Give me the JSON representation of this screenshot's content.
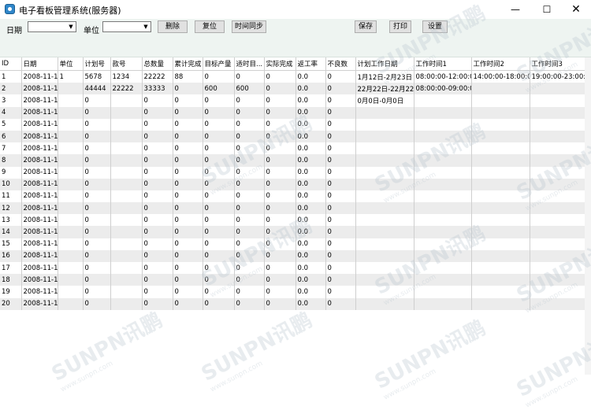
{
  "window": {
    "title": "电子看板管理系统(服务器)",
    "min": "—",
    "max": "☐",
    "close": "✕"
  },
  "toolbar": {
    "date_label": "日期",
    "unit_label": "单位",
    "date_value": "",
    "unit_value": "",
    "delete_label": "删除",
    "reset_label": "复位",
    "sync_label": "时间同步",
    "save_label": "保存",
    "print_label": "打印",
    "settings_label": "设置"
  },
  "grid": {
    "columns": [
      "ID",
      "日期",
      "单位",
      "计划号",
      "款号",
      "总数量",
      "累计完成",
      "目标产量",
      "适时目...",
      "实际完成",
      "返工率",
      "不良数",
      "计划工作日期",
      "工作时间1",
      "工作时间2",
      "工作时间3"
    ],
    "rows": [
      [
        "1",
        "2008-11-19",
        "1",
        "5678",
        "1234",
        "22222",
        "88",
        "0",
        "0",
        "0",
        "0.0",
        "0",
        "1月12日-2月23日",
        "08:00:00-12:00:00",
        "14:00:00-18:00:00",
        "19:00:00-23:00:00"
      ],
      [
        "2",
        "2008-11-18",
        "",
        "44444",
        "22222",
        "33333",
        "0",
        "600",
        "600",
        "0",
        "0.0",
        "0",
        "22月22日-22月22日",
        "08:00:00-09:00:00",
        "",
        ""
      ],
      [
        "3",
        "2008-11-15",
        "",
        "0",
        "",
        "0",
        "0",
        "0",
        "0",
        "0",
        "0.0",
        "0",
        "0月0日-0月0日",
        "",
        "",
        ""
      ],
      [
        "4",
        "2008-11-15",
        "",
        "0",
        "",
        "0",
        "0",
        "0",
        "0",
        "0",
        "0.0",
        "0",
        "",
        "",
        "",
        ""
      ],
      [
        "5",
        "2008-11-15",
        "",
        "0",
        "",
        "0",
        "0",
        "0",
        "0",
        "0",
        "0.0",
        "0",
        "",
        "",
        "",
        ""
      ],
      [
        "6",
        "2008-11-15",
        "",
        "0",
        "",
        "0",
        "0",
        "0",
        "0",
        "0",
        "0.0",
        "0",
        "",
        "",
        "",
        ""
      ],
      [
        "7",
        "2008-11-15",
        "",
        "0",
        "",
        "0",
        "0",
        "0",
        "0",
        "0",
        "0.0",
        "0",
        "",
        "",
        "",
        ""
      ],
      [
        "8",
        "2008-11-15",
        "",
        "0",
        "",
        "0",
        "0",
        "0",
        "0",
        "0",
        "0.0",
        "0",
        "",
        "",
        "",
        ""
      ],
      [
        "9",
        "2008-11-15",
        "",
        "0",
        "",
        "0",
        "0",
        "0",
        "0",
        "0",
        "0.0",
        "0",
        "",
        "",
        "",
        ""
      ],
      [
        "10",
        "2008-11-15",
        "",
        "0",
        "",
        "0",
        "0",
        "0",
        "0",
        "0",
        "0.0",
        "0",
        "",
        "",
        "",
        ""
      ],
      [
        "11",
        "2008-11-15",
        "",
        "0",
        "",
        "0",
        "0",
        "0",
        "0",
        "0",
        "0.0",
        "0",
        "",
        "",
        "",
        ""
      ],
      [
        "12",
        "2008-11-15",
        "",
        "0",
        "",
        "0",
        "0",
        "0",
        "0",
        "0",
        "0.0",
        "0",
        "",
        "",
        "",
        ""
      ],
      [
        "13",
        "2008-11-15",
        "",
        "0",
        "",
        "0",
        "0",
        "0",
        "0",
        "0",
        "0.0",
        "0",
        "",
        "",
        "",
        ""
      ],
      [
        "14",
        "2008-11-15",
        "",
        "0",
        "",
        "0",
        "0",
        "0",
        "0",
        "0",
        "0.0",
        "0",
        "",
        "",
        "",
        ""
      ],
      [
        "15",
        "2008-11-15",
        "",
        "0",
        "",
        "0",
        "0",
        "0",
        "0",
        "0",
        "0.0",
        "0",
        "",
        "",
        "",
        ""
      ],
      [
        "16",
        "2008-11-15",
        "",
        "0",
        "",
        "0",
        "0",
        "0",
        "0",
        "0",
        "0.0",
        "0",
        "",
        "",
        "",
        ""
      ],
      [
        "17",
        "2008-11-15",
        "",
        "0",
        "",
        "0",
        "0",
        "0",
        "0",
        "0",
        "0.0",
        "0",
        "",
        "",
        "",
        ""
      ],
      [
        "18",
        "2008-11-15",
        "",
        "0",
        "",
        "0",
        "0",
        "0",
        "0",
        "0",
        "0.0",
        "0",
        "",
        "",
        "",
        ""
      ],
      [
        "19",
        "2008-11-15",
        "",
        "0",
        "",
        "0",
        "0",
        "0",
        "0",
        "0",
        "0.0",
        "0",
        "",
        "",
        "",
        ""
      ],
      [
        "20",
        "2008-11-15",
        "",
        "0",
        "",
        "0",
        "0",
        "0",
        "0",
        "0",
        "0.0",
        "0",
        "",
        "",
        "",
        ""
      ]
    ]
  },
  "watermark": {
    "brand": "SUNPN讯鹏",
    "url": "www.sunpn.com"
  }
}
